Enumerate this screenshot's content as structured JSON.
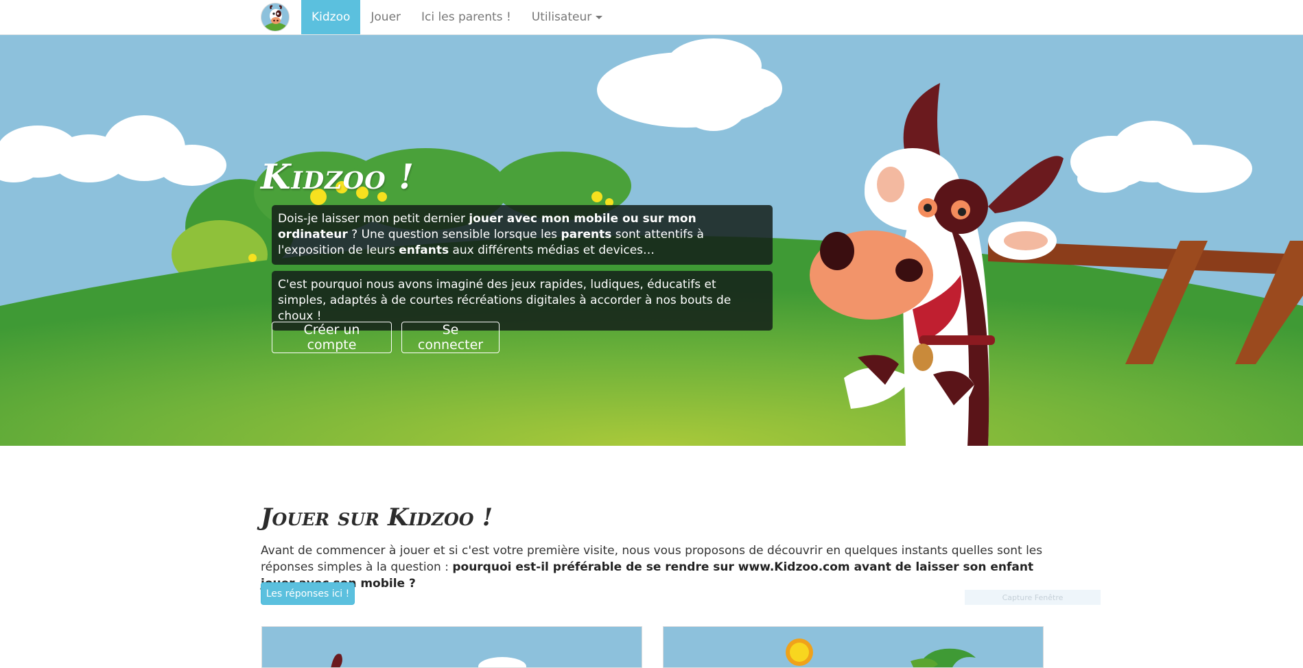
{
  "nav": {
    "logo_alt": "Kidzoo",
    "items": [
      {
        "label": "Kidzoo",
        "active": true
      },
      {
        "label": "Jouer"
      },
      {
        "label": "Ici les parents !"
      },
      {
        "label": "Utilisateur",
        "dropdown": true
      }
    ]
  },
  "hero": {
    "title": "Kidzoo !",
    "box1": {
      "t1": "Dois-je laisser mon petit dernier ",
      "b1": "jouer avec mon mobile ou sur mon ordinateur",
      "t2": " ? Une question sensible lorsque les ",
      "b2": "parents",
      "t3": " sont attentifs à l'exposition de leurs ",
      "b3": "enfants",
      "t4": " aux différents médias et devices…"
    },
    "box2": "C'est pourquoi nous avons imaginé des jeux rapides, ludiques, éducatifs et simples, adaptés à de courtes récréations digitales à accorder à nos bouts de choux !",
    "btn_create": "Créer un compte",
    "btn_login": "Se connecter"
  },
  "section": {
    "title": "Jouer sur Kidzoo !",
    "t1": "Avant de commencer à jouer et si c'est votre première visite, nous vous proposons de découvrir en quelques instants quelles sont les réponses simples à la question : ",
    "b1": "pourquoi est-il préférable de se rendre sur www.Kidzoo.com avant de laisser son enfant jouer avec son mobile ?",
    "button": "Les réponses ici !",
    "capture_label": "Capture Fenêtre"
  },
  "colors": {
    "accent": "#5bc0de",
    "sky": "#8dc1dc",
    "grass": "#5aa530"
  },
  "icons": [
    "cow-logo-icon",
    "caret-down-icon"
  ]
}
